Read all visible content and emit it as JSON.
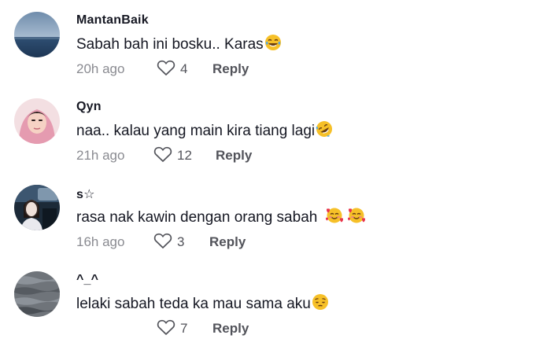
{
  "comments": [
    {
      "username": "MantanBaik",
      "text": "Sabah bah ini bosku.. Karas",
      "emojis": [
        "face-with-tears-of-joy"
      ],
      "time": "20h ago",
      "likes": "4",
      "reply_label": "Reply",
      "avatar": "sea-horizon-avatar"
    },
    {
      "username": "Qyn",
      "text": "naa.. kalau yang main kira tiang lagi",
      "emojis": [
        "rolling-on-floor-laughing"
      ],
      "time": "21h ago",
      "likes": "12",
      "reply_label": "Reply",
      "avatar": "hijab-girl-avatar"
    },
    {
      "username": "s☆",
      "text": "rasa nak kawin dengan orang sabah ",
      "emojis": [
        "smiling-face-with-hearts",
        "smiling-face-with-hearts"
      ],
      "time": "16h ago",
      "likes": "3",
      "reply_label": "Reply",
      "avatar": "car-selfie-avatar"
    },
    {
      "username": "^_^",
      "text": "lelaki sabah teda ka mau sama aku",
      "emojis": [
        "pensive-face"
      ],
      "time": "",
      "likes": "7",
      "reply_label": "Reply",
      "avatar": "water-waves-avatar"
    }
  ],
  "colors": {
    "text": "#161823",
    "muted": "#8a8b91",
    "action": "#52535a"
  }
}
